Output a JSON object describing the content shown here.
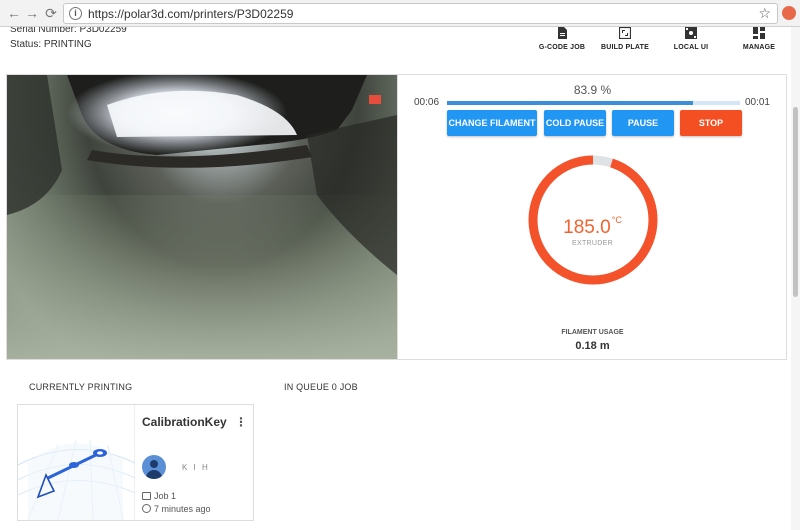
{
  "browser": {
    "url": "https://polar3d.com/printers/P3D02259",
    "back_icon": "←",
    "forward_icon": "→",
    "reload_icon": "⟳",
    "lock_icon": "i",
    "star_icon": "☆"
  },
  "printer": {
    "serial_label": "Serial Number: P3D02259",
    "status_label": "Status: PRINTING"
  },
  "toolbar": [
    {
      "label": "G-CODE JOB",
      "icon": "file-icon"
    },
    {
      "label": "BUILD PLATE",
      "icon": "build-plate-icon"
    },
    {
      "label": "LOCAL UI",
      "icon": "local-ui-icon"
    },
    {
      "label": "MANAGE",
      "icon": "dashboard-icon"
    }
  ],
  "progress": {
    "percent_text": "83.9 %",
    "percent": 83.9,
    "elapsed": "00:06",
    "remaining": "00:01"
  },
  "buttons": {
    "change_filament": "CHANGE FILAMENT",
    "cold_pause": "COLD PAUSE",
    "pause": "PAUSE",
    "stop": "STOP"
  },
  "extruder": {
    "temp": "185.0",
    "unit": "°C",
    "label": "EXTRUDER",
    "ring_fraction": 0.95
  },
  "filament": {
    "label": "FILAMENT USAGE",
    "value": "0.18 m"
  },
  "sections": {
    "currently_printing": "CURRENTLY PRINTING",
    "in_queue": "IN QUEUE 0 JOB"
  },
  "job": {
    "title": "CalibrationKey",
    "menu_icon": "⋮",
    "user": "K I H",
    "job_label": "Job 1",
    "time": "7 minutes ago"
  },
  "colors": {
    "accent_blue": "#2196f3",
    "stop_red": "#f44f22",
    "ring_orange": "#f4522a",
    "ring_track": "#dfe3e6"
  }
}
